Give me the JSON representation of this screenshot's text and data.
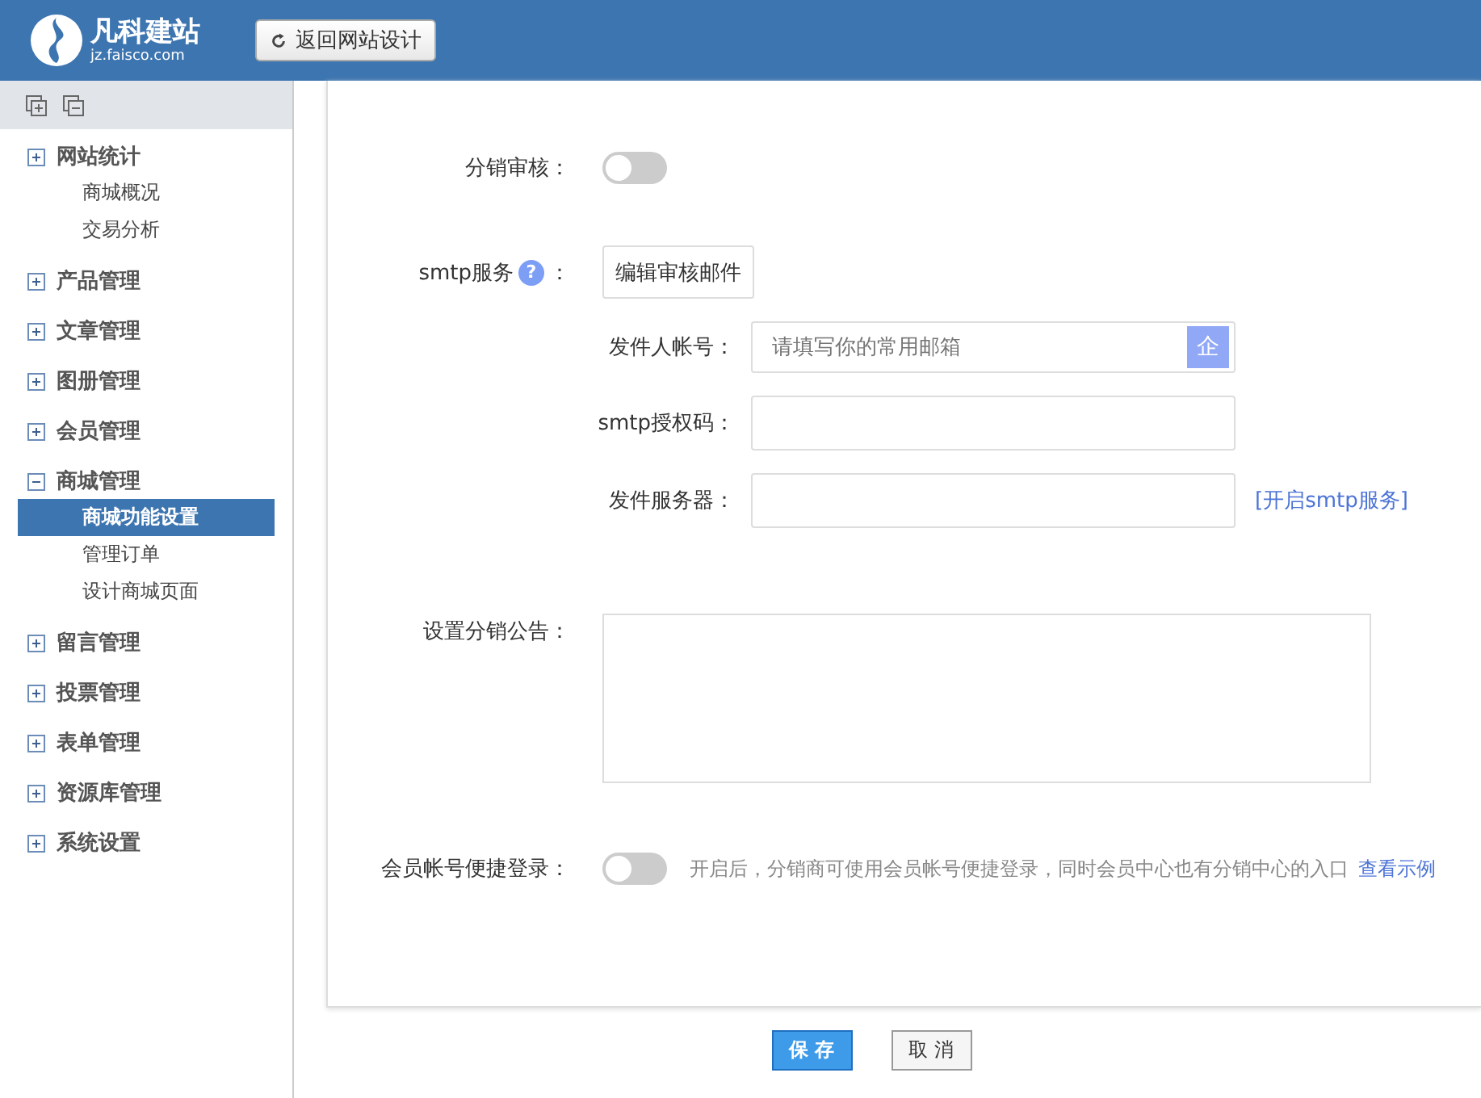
{
  "header": {
    "logo_name": "凡科建站",
    "logo_domain": "jz.faisco.com",
    "back_button": "返回网站设计"
  },
  "sidebar": {
    "items": [
      {
        "label": "网站统计",
        "expanded": false,
        "children": [
          {
            "label": "商城概况",
            "selected": false
          },
          {
            "label": "交易分析",
            "selected": false
          }
        ]
      },
      {
        "label": "产品管理",
        "expanded": false
      },
      {
        "label": "文章管理",
        "expanded": false
      },
      {
        "label": "图册管理",
        "expanded": false
      },
      {
        "label": "会员管理",
        "expanded": false
      },
      {
        "label": "商城管理",
        "expanded": true,
        "children": [
          {
            "label": "商城功能设置",
            "selected": true
          },
          {
            "label": "管理订单",
            "selected": false
          },
          {
            "label": "设计商城页面",
            "selected": false
          }
        ]
      },
      {
        "label": "留言管理",
        "expanded": false
      },
      {
        "label": "投票管理",
        "expanded": false
      },
      {
        "label": "表单管理",
        "expanded": false
      },
      {
        "label": "资源库管理",
        "expanded": false
      },
      {
        "label": "系统设置",
        "expanded": false
      }
    ]
  },
  "form": {
    "review": {
      "label": "分销审核：",
      "on": false
    },
    "smtp": {
      "label": "smtp服务",
      "colon": "：",
      "help": "?",
      "edit_button": "编辑审核邮件",
      "fields": [
        {
          "label": "发件人帐号：",
          "placeholder": "请填写你的常用邮箱",
          "badge": "企"
        },
        {
          "label": "smtp授权码："
        },
        {
          "label": "发件服务器：",
          "link": "[开启smtp服务]"
        }
      ]
    },
    "notice": {
      "label": "设置分销公告："
    },
    "member_login": {
      "label": "会员帐号便捷登录：",
      "on": false,
      "hint": "开启后，分销商可使用会员帐号便捷登录，同时会员中心也有分销中心的入口",
      "link": "查看示例"
    }
  },
  "buttons": {
    "save": "保 存",
    "cancel": "取 消"
  }
}
